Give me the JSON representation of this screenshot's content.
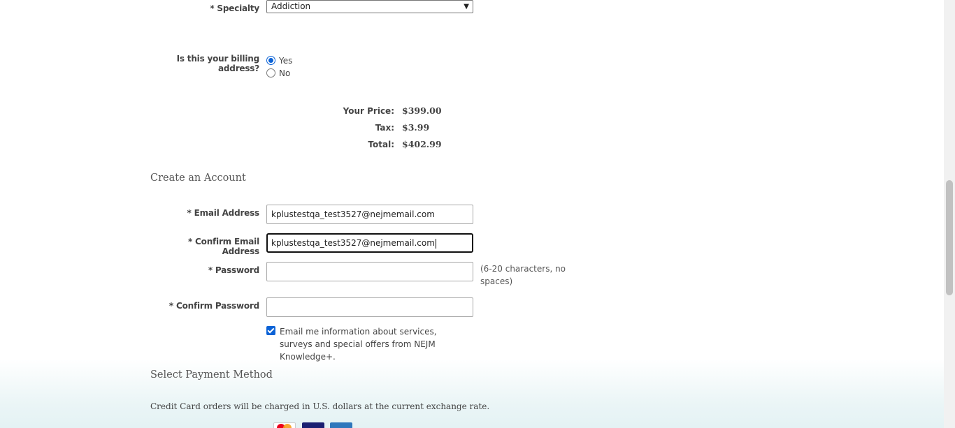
{
  "specialty": {
    "label": "* Specialty",
    "selected": "Addiction"
  },
  "billing": {
    "question": "Is this your billing address?",
    "options": [
      {
        "label": "Yes",
        "checked": true
      },
      {
        "label": "No",
        "checked": false
      }
    ]
  },
  "pricing": {
    "price_label": "Your Price:",
    "price_value": "$399.00",
    "tax_label": "Tax:",
    "tax_value": "$3.99",
    "total_label": "Total:",
    "total_value": "$402.99"
  },
  "account": {
    "title": "Create an Account",
    "email_label": "* Email Address",
    "email_value": "kplustestqa_test3527@nejmemail.com",
    "confirm_email_label": "* Confirm Email Address",
    "confirm_email_value": "kplustestqa_test3527@nejmemail.com",
    "password_label": "* Password",
    "password_value": "",
    "password_hint": "(6-20 characters, no spaces)",
    "confirm_password_label": "* Confirm Password",
    "confirm_password_value": "",
    "optin_checked": true,
    "optin_label": "Email me information about services, surveys and special offers from NEJM Knowledge+."
  },
  "payment": {
    "title": "Select Payment Method",
    "note": "Credit Card orders will be charged in U.S. dollars at the current exchange rate.",
    "cards": [
      {
        "icon": "mastercard-icon",
        "color": "#eb001b"
      },
      {
        "icon": "visa-icon",
        "color": "#1a1f71"
      },
      {
        "icon": "amex-icon",
        "color": "#2e77bc"
      }
    ]
  }
}
